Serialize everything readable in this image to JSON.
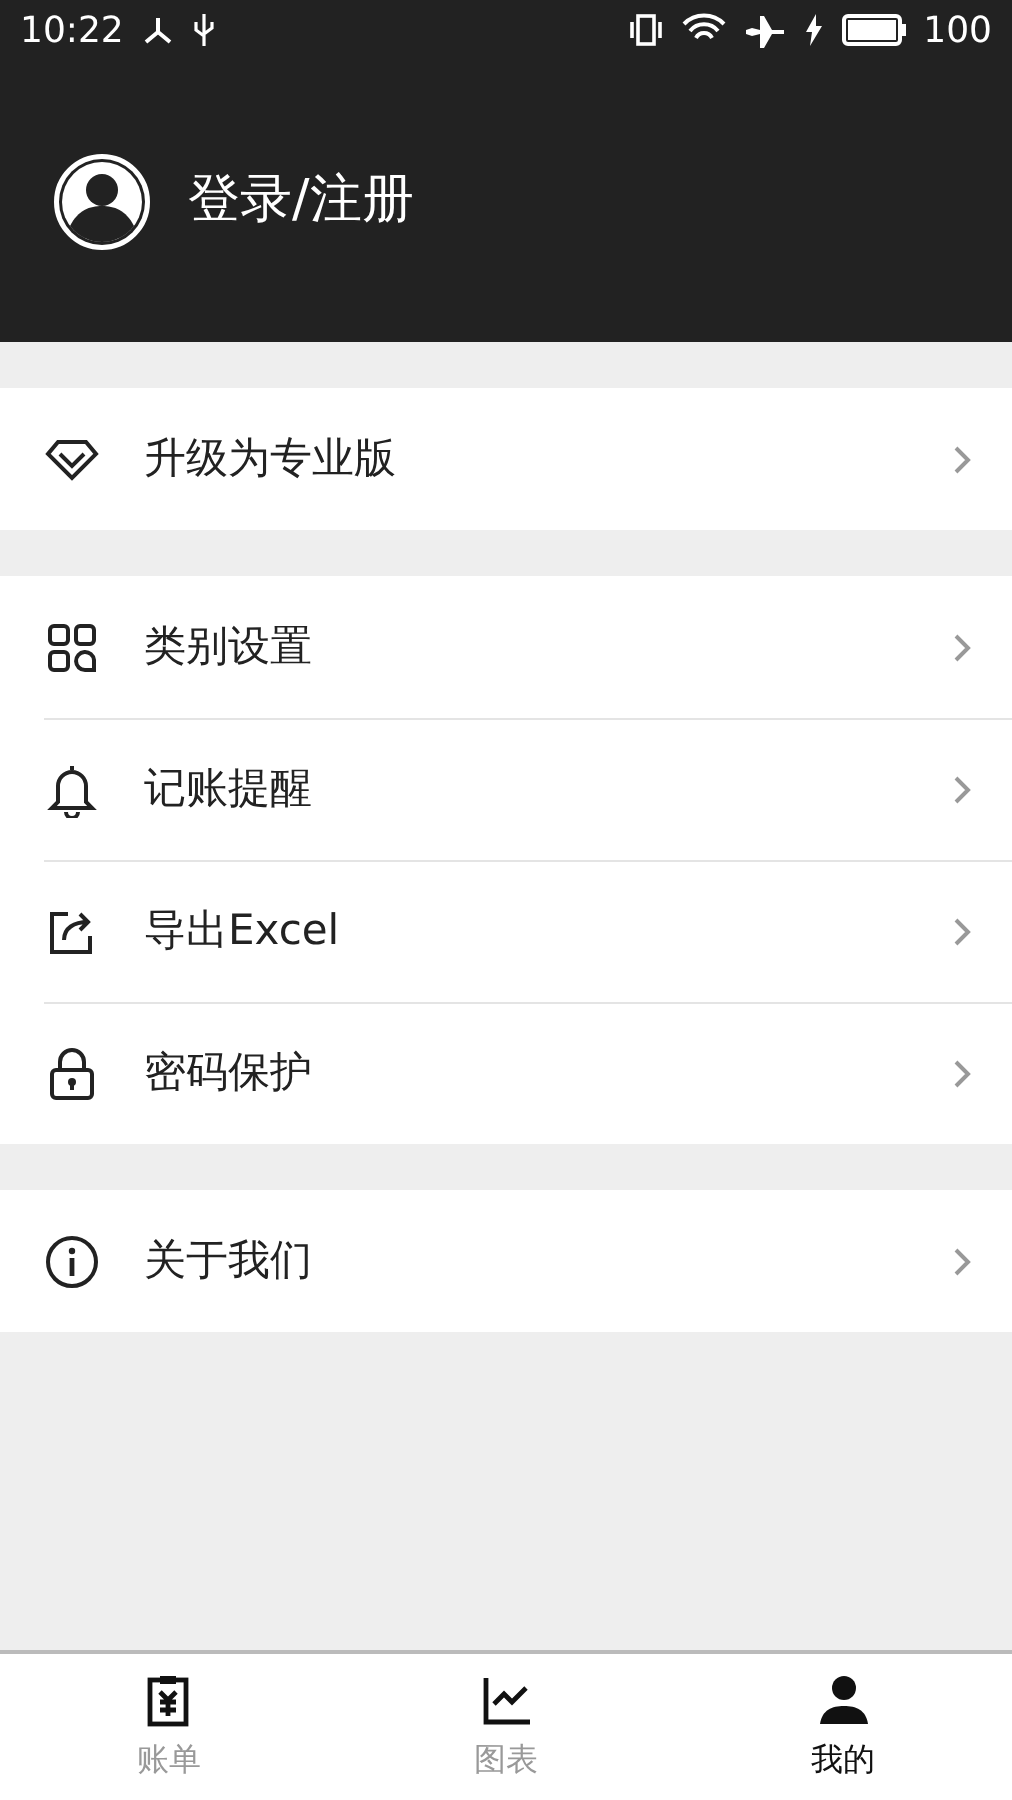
{
  "status_bar": {
    "time": "10:22",
    "battery": "100"
  },
  "header": {
    "title": "登录/注册"
  },
  "menu_groups": [
    {
      "items": [
        {
          "kind": "diamond",
          "label": "升级为专业版"
        }
      ]
    },
    {
      "items": [
        {
          "kind": "grid",
          "label": "类别设置"
        },
        {
          "kind": "bell",
          "label": "记账提醒"
        },
        {
          "kind": "export",
          "label": "导出Excel"
        },
        {
          "kind": "lock",
          "label": "密码保护"
        }
      ]
    },
    {
      "items": [
        {
          "kind": "info",
          "label": "关于我们"
        }
      ]
    }
  ],
  "tabs": [
    {
      "kind": "bill",
      "label": "账单",
      "selected": false
    },
    {
      "kind": "chart",
      "label": "图表",
      "selected": false
    },
    {
      "kind": "person",
      "label": "我的",
      "selected": true
    }
  ]
}
